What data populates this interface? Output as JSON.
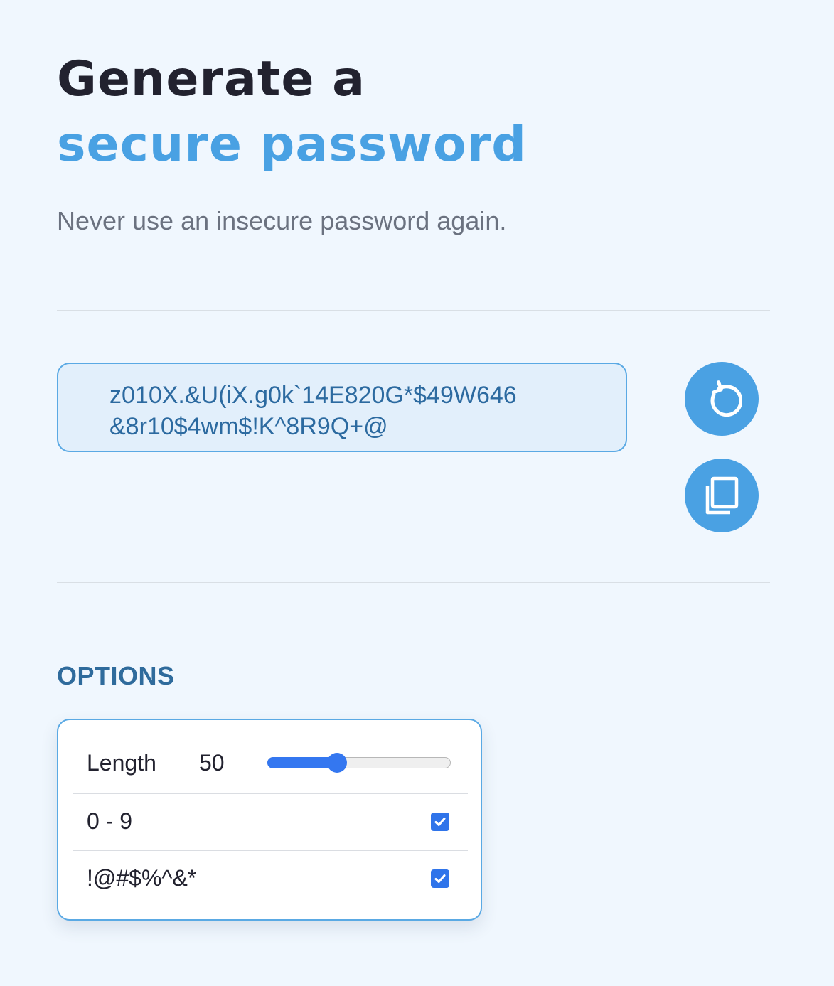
{
  "header": {
    "title_line1": "Generate a",
    "title_line2": "secure password",
    "subtitle": "Never use an insecure password again."
  },
  "password": {
    "value": "z010X.&U(iX.g0k`14E820G*$49W646\n&8r10$4wm$!K^8R9Q+@"
  },
  "actions": {
    "regenerate_icon": "refresh-icon",
    "copy_icon": "copy-icon"
  },
  "options": {
    "heading": "OPTIONS",
    "length": {
      "label": "Length",
      "value": "50",
      "slider_fraction": 0.38
    },
    "digits": {
      "label": "0 - 9",
      "checked": true
    },
    "symbols": {
      "label": "!@#$%^&*",
      "checked": true
    }
  },
  "colors": {
    "background": "#f0f7fe",
    "accent": "#49a1e3",
    "title": "#22222f",
    "checkbox": "#2f74ea"
  }
}
